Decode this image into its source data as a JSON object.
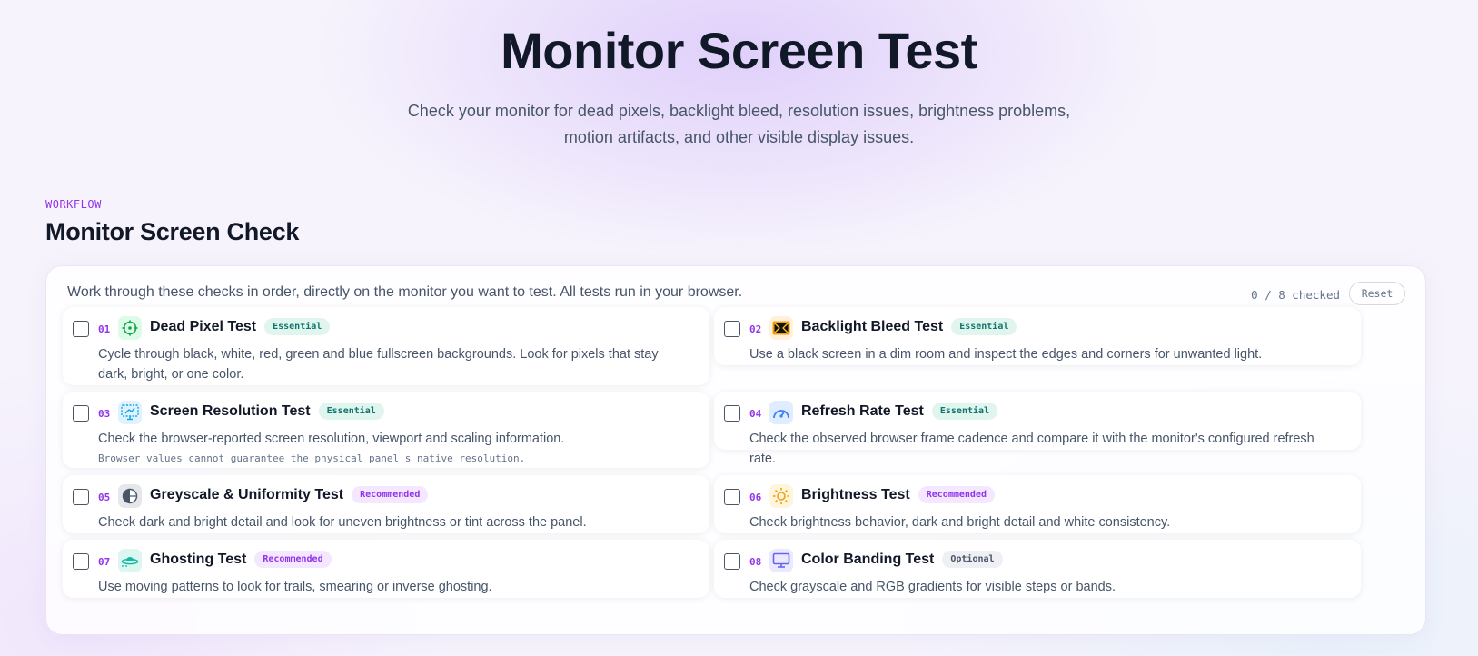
{
  "hero": {
    "title": "Monitor Screen Test",
    "subtitle_line1": "Check your monitor for dead pixels, backlight bleed, resolution issues, brightness problems,",
    "subtitle_line2": "motion artifacts, and other visible display issues."
  },
  "section": {
    "label": "WORKFLOW",
    "title": "Monitor Screen Check"
  },
  "panel": {
    "intro": "Work through these checks in order, directly on the monitor you want to test. All tests run in your browser.",
    "progress": "0 / 8 checked",
    "reset_label": "Reset"
  },
  "checks": [
    {
      "num": "01",
      "title": "Dead Pixel Test",
      "badge": "Essential",
      "desc": "Cycle through black, white, red, green and blue fullscreen backgrounds. Look for pixels that stay dark, bright, or one color.",
      "icon": "crosshair-icon",
      "checked": false
    },
    {
      "num": "02",
      "title": "Backlight Bleed Test",
      "badge": "Essential",
      "desc": "Use a black screen in a dim room and inspect the edges and corners for unwanted light.",
      "icon": "backlight-icon",
      "checked": false
    },
    {
      "num": "03",
      "title": "Screen Resolution Test",
      "badge": "Essential",
      "desc": "Check the browser-reported screen resolution, viewport and scaling information.",
      "note": "Browser values cannot guarantee the physical panel's native resolution.",
      "icon": "resolution-icon",
      "checked": false
    },
    {
      "num": "04",
      "title": "Refresh Rate Test",
      "badge": "Essential",
      "desc": "Check the observed browser frame cadence and compare it with the monitor's configured refresh rate.",
      "icon": "gauge-icon",
      "checked": false
    },
    {
      "num": "05",
      "title": "Greyscale & Uniformity Test",
      "badge": "Recommended",
      "desc": "Check dark and bright detail and look for uneven brightness or tint across the panel.",
      "icon": "half-circle-icon",
      "checked": false
    },
    {
      "num": "06",
      "title": "Brightness Test",
      "badge": "Recommended",
      "desc": "Check brightness behavior, dark and bright detail and white consistency.",
      "icon": "sun-icon",
      "checked": false
    },
    {
      "num": "07",
      "title": "Ghosting Test",
      "badge": "Recommended",
      "desc": "Use moving patterns to look for trails, smearing or inverse ghosting.",
      "icon": "ufo-icon",
      "checked": false
    },
    {
      "num": "08",
      "title": "Color Banding Test",
      "badge": "Optional",
      "desc": "Check grayscale and RGB gradients for visible steps or bands.",
      "icon": "monitor-icon",
      "checked": false
    }
  ],
  "colors": {
    "accent": "#9333ea",
    "essential_badge_bg": "#e0f5ee",
    "essential_badge_text": "#0f766e",
    "recommended_badge_bg": "#f3e8ff",
    "recommended_badge_text": "#9333ea",
    "optional_badge_bg": "#eef0f3",
    "optional_badge_text": "#475569"
  }
}
